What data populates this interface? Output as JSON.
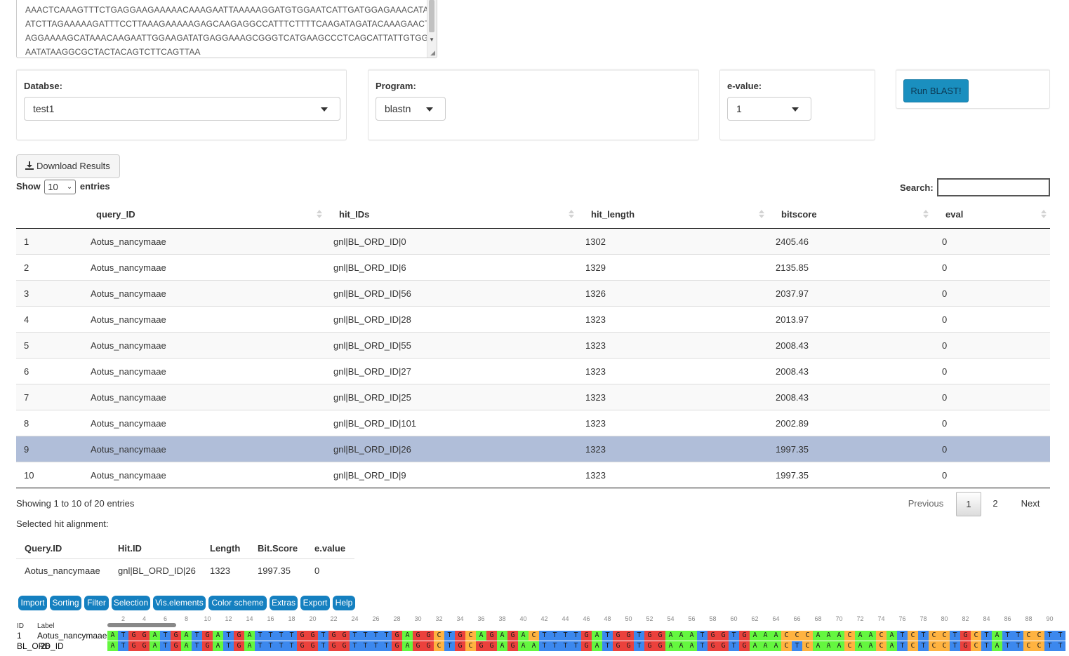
{
  "sequence": {
    "lines": [
      "AAACTCAAAGTTTCTGAGGAAGAAAAACAAAGAATTAAAAAGGATGTGGAATCATTGATGGAGAAACATAGT",
      "ATCTTAGAAAAAGATTTCCTTAAAGAAAAAGAGCAAGAGGCCATTTCTTTTCAAGATAGATACAAAGAACTTC",
      "AGGAAAAGCATAAACAAGAATTGGAAGATATGAGGAAAGCGGGTCATGAAGCCCTCAGCATTATTGTGGATG",
      "AATATAAGGCGCTACTACAGTCTTCAGTTAA"
    ]
  },
  "controls": {
    "database_label": "Databse:",
    "database_value": "test1",
    "program_label": "Program:",
    "program_value": "blastn",
    "evalue_label": "e-value:",
    "evalue_value": "1",
    "run_button": "Run BLAST!"
  },
  "download_button": "Download Results",
  "table_controls": {
    "show": "Show",
    "entries_value": "10",
    "entries": "entries",
    "search_label": "Search:",
    "search_value": ""
  },
  "table": {
    "columns": [
      "query_ID",
      "hit_IDs",
      "hit_length",
      "bitscore",
      "eval"
    ],
    "rows": [
      [
        "1",
        "Aotus_nancymaae",
        "gnl|BL_ORD_ID|0",
        "1302",
        "2405.46",
        "0"
      ],
      [
        "2",
        "Aotus_nancymaae",
        "gnl|BL_ORD_ID|6",
        "1329",
        "2135.85",
        "0"
      ],
      [
        "3",
        "Aotus_nancymaae",
        "gnl|BL_ORD_ID|56",
        "1326",
        "2037.97",
        "0"
      ],
      [
        "4",
        "Aotus_nancymaae",
        "gnl|BL_ORD_ID|28",
        "1323",
        "2013.97",
        "0"
      ],
      [
        "5",
        "Aotus_nancymaae",
        "gnl|BL_ORD_ID|55",
        "1323",
        "2008.43",
        "0"
      ],
      [
        "6",
        "Aotus_nancymaae",
        "gnl|BL_ORD_ID|27",
        "1323",
        "2008.43",
        "0"
      ],
      [
        "7",
        "Aotus_nancymaae",
        "gnl|BL_ORD_ID|25",
        "1323",
        "2008.43",
        "0"
      ],
      [
        "8",
        "Aotus_nancymaae",
        "gnl|BL_ORD_ID|101",
        "1323",
        "2002.89",
        "0"
      ],
      [
        "9",
        "Aotus_nancymaae",
        "gnl|BL_ORD_ID|26",
        "1323",
        "1997.35",
        "0"
      ],
      [
        "10",
        "Aotus_nancymaae",
        "gnl|BL_ORD_ID|9",
        "1323",
        "1997.35",
        "0"
      ]
    ],
    "selected_row": 9,
    "info": "Showing 1 to 10 of 20 entries",
    "pagination": {
      "previous": "Previous",
      "pages": [
        "1",
        "2"
      ],
      "current": "1",
      "next": "Next"
    }
  },
  "selected_hit": {
    "title": "Selected hit alignment:",
    "headers": [
      "Query.ID",
      "Hit.ID",
      "Length",
      "Bit.Score",
      "e.value"
    ],
    "values": [
      "Aotus_nancymaae",
      "gnl|BL_ORD_ID|26",
      "1323",
      "1997.35",
      "0"
    ]
  },
  "msa": {
    "menu": [
      "Import",
      "Sorting",
      "Filter",
      "Selection",
      "Vis.elements",
      "Color scheme",
      "Extras",
      "Export",
      "Help"
    ],
    "header_id": "ID",
    "header_label": "Label",
    "ruler_ticks": [
      "2",
      "4",
      "6",
      "8",
      "10",
      "12",
      "14",
      "16",
      "18",
      "20",
      "22",
      "24",
      "26",
      "28",
      "30",
      "32",
      "34",
      "36",
      "38",
      "40",
      "42",
      "44",
      "46",
      "48",
      "50",
      "52",
      "54",
      "56",
      "58",
      "60",
      "62",
      "64",
      "66",
      "68",
      "70",
      "72",
      "74",
      "76",
      "78",
      "80",
      "82",
      "84",
      "86",
      "88",
      "90"
    ],
    "sequences": [
      {
        "id": "1",
        "label": "Aotus_nancymaae",
        "seq": "ATGGATGATGATGATTTTGGTGGTTTTGAGGCTGCAGAGACTTTTGATGGTGGAAATGGTGAAACCCAAACAACATCTCCTGCTATTCCTT"
      },
      {
        "id": "BL_ORD_ID",
        "label": "26",
        "seq": "ATGGATGATGATGATTTTGGTGGTTTTGAGGCTGCGGAGAATTTTGATGGTGGAAATGGTGAAACTCAAACAACATCTCCTGCTATTCCTT"
      }
    ],
    "nucleotide_colors": {
      "A": "#64f73f",
      "T": "#3c88ee",
      "G": "#eb413c",
      "C": "#ffb340"
    }
  }
}
